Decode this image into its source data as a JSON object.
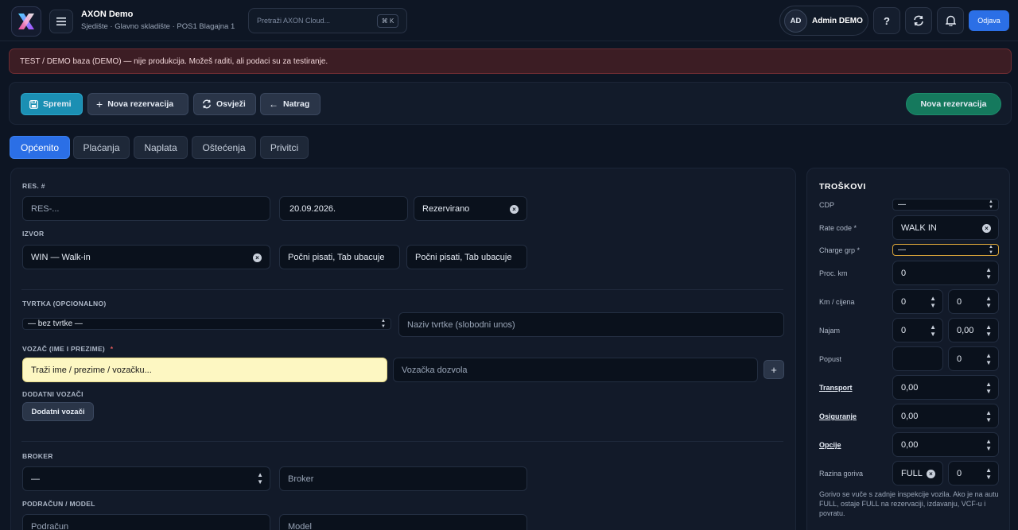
{
  "header": {
    "app_title": "AXON Demo",
    "app_subtitle": "Sjedište · Glavno skladište · POS1 Blagajna 1",
    "search_placeholder": "Pretraži AXON Cloud...",
    "search_shortcut": "⌘ K",
    "user_initials": "AD",
    "user_name": "Admin DEMO",
    "help_label": "?",
    "logout_label": "Odjava"
  },
  "banner": {
    "text": "TEST / DEMO baza (DEMO) — nije produkcija. Možeš raditi, ali podaci su za testiranje."
  },
  "toolbar": {
    "save": "Spremi",
    "new_reservation": "Nova rezervacija",
    "refresh": "Osvježi",
    "back": "Natrag",
    "new_reservation_right": "Nova rezervacija"
  },
  "tabs": [
    "Općenito",
    "Plaćanja",
    "Naplata",
    "Oštećenja",
    "Privitci"
  ],
  "form": {
    "res_label": "RES. #",
    "res_placeholder": "RES-...",
    "date": "20.09.2026.",
    "status": "Rezervirano",
    "source_label": "IZVOR",
    "source_value": "WIN — Walk-in",
    "source_ph1": "Počni pisati, Tab ubacuje",
    "source_ph2": "Počni pisati, Tab ubacuje",
    "company_label": "TVRTKA (OPCIONALNO)",
    "company_select": "— bez tvrtke —",
    "company_name_ph": "Naziv tvrtke (slobodni unos)",
    "driver_label": "VOZAČ (IME I PREZIME)",
    "driver_required": "*",
    "driver_search_ph": "Traži ime / prezime / vozačku...",
    "license_ph": "Vozačka dozvola",
    "add_driver_plus": "+",
    "extra_drivers_label": "DODATNI VOZAČI",
    "extra_drivers_button": "Dodatni vozači",
    "broker_label": "BROKER",
    "broker_select": "—",
    "broker_ph": "Broker",
    "subaccount_label": "PODRAČUN / MODEL",
    "subaccount_ph": "Podračun",
    "model_ph": "Model"
  },
  "costs": {
    "title": "TROŠKOVI",
    "cdp_label": "CDP",
    "cdp_value": "—",
    "rate_label": "Rate code *",
    "rate_value": "WALK IN",
    "charge_label": "Charge grp *",
    "charge_value": "—",
    "proc_label": "Proc. km",
    "proc_value": "0",
    "km_label": "Km / cijena",
    "km_value": "0",
    "km_price": "0",
    "najam_label": "Najam",
    "najam_value": "0",
    "najam_price": "0,00",
    "popust_label": "Popust",
    "popust_value": "",
    "popust_value2": "0",
    "transport_label": "Transport",
    "transport_value": "0,00",
    "osiguranje_label": "Osiguranje",
    "osiguranje_value": "0,00",
    "opcije_label": "Opcije",
    "opcije_value": "0,00",
    "fuel_label": "Razina goriva",
    "fuel_value": "FULL",
    "fuel_value2": "0",
    "fuel_note": "Gorivo se vuče s zadnje inspekcije vozila. Ako je na autu FULL, ostaje FULL na rezervaciji, izdavanju, VCF-u i povratu."
  },
  "colors": {
    "accent": "#2b6fe6",
    "primary_button": "#1b8fb3",
    "green_button": "#15795d",
    "banner_bg": "#3c1d24",
    "highlight_field": "#fdf7c2"
  }
}
